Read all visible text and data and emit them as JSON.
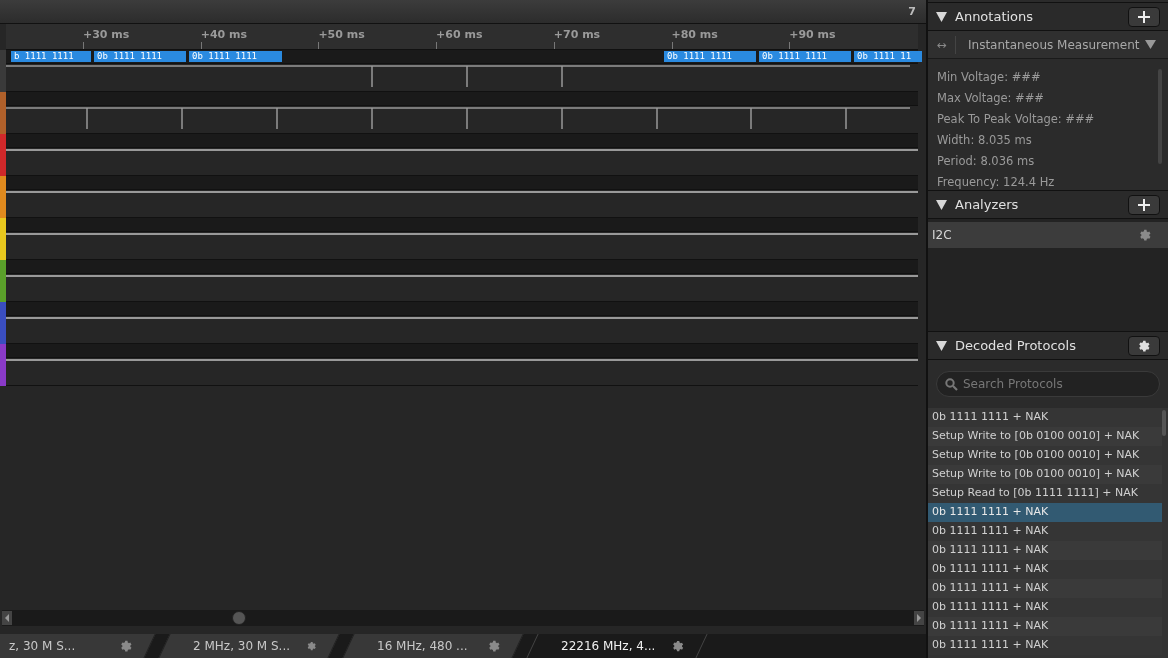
{
  "timeline": {
    "ticks": [
      "+30 ms",
      "+40 ms",
      "+50 ms",
      "+60 ms",
      "+70 ms",
      "+80 ms",
      "+90 ms"
    ],
    "corner_label": "7"
  },
  "channels": [
    {
      "color": "#3a3a3a",
      "bubbles": [
        "b 1111 1111",
        "0b 1111 1111",
        "0b 1111 1111",
        "0b 1111 1111",
        "0b 1111 1111",
        "0b 1111 11"
      ]
    },
    {
      "color": "#b0602a"
    },
    {
      "color": "#d0282a"
    },
    {
      "color": "#e08a1e"
    },
    {
      "color": "#e8c81e"
    },
    {
      "color": "#5aa02a"
    },
    {
      "color": "#3a4ec0"
    },
    {
      "color": "#8a3ac8"
    }
  ],
  "capture_tabs": [
    {
      "label": "z, 30 M S...",
      "selected": false
    },
    {
      "label": "2 MHz, 30 M S...",
      "selected": false
    },
    {
      "label": "16 MHz, 480 ...",
      "selected": false
    },
    {
      "label": "22216 MHz, 4...",
      "selected": true
    }
  ],
  "annotations": {
    "title": "Annotations",
    "measurement_icon": "↔",
    "measurement": "Instantaneous Measurement",
    "lines": [
      "Min Voltage: ###",
      "Max Voltage: ###",
      "Peak To Peak Voltage: ###",
      "Width: 8.035 ms",
      "Period: 8.036 ms",
      "Frequency: 124.4 Hz"
    ]
  },
  "analyzers": {
    "title": "Analyzers",
    "items": [
      "I2C"
    ]
  },
  "decoded_protocols": {
    "title": "Decoded Protocols",
    "search": {
      "placeholder": "Search Protocols"
    },
    "rows": [
      {
        "text": "0b 1111 1111 + NAK",
        "selected": false
      },
      {
        "text": "Setup Write to [0b 0100 0010] + NAK",
        "selected": false
      },
      {
        "text": "Setup Write to [0b 0100 0010] + NAK",
        "selected": false
      },
      {
        "text": "Setup Write to [0b 0100 0010] + NAK",
        "selected": false
      },
      {
        "text": "Setup Read to [0b 1111 1111] + NAK",
        "selected": false
      },
      {
        "text": "0b 1111 1111 + NAK",
        "selected": true
      },
      {
        "text": "0b 1111 1111 + NAK",
        "selected": false
      },
      {
        "text": "0b 1111 1111 + NAK",
        "selected": false
      },
      {
        "text": "0b 1111 1111 + NAK",
        "selected": false
      },
      {
        "text": "0b 1111 1111 + NAK",
        "selected": false
      },
      {
        "text": "0b 1111 1111 + NAK",
        "selected": false
      },
      {
        "text": "0b 1111 1111 + NAK",
        "selected": false
      },
      {
        "text": "0b 1111 1111 + NAK",
        "selected": false
      }
    ]
  }
}
